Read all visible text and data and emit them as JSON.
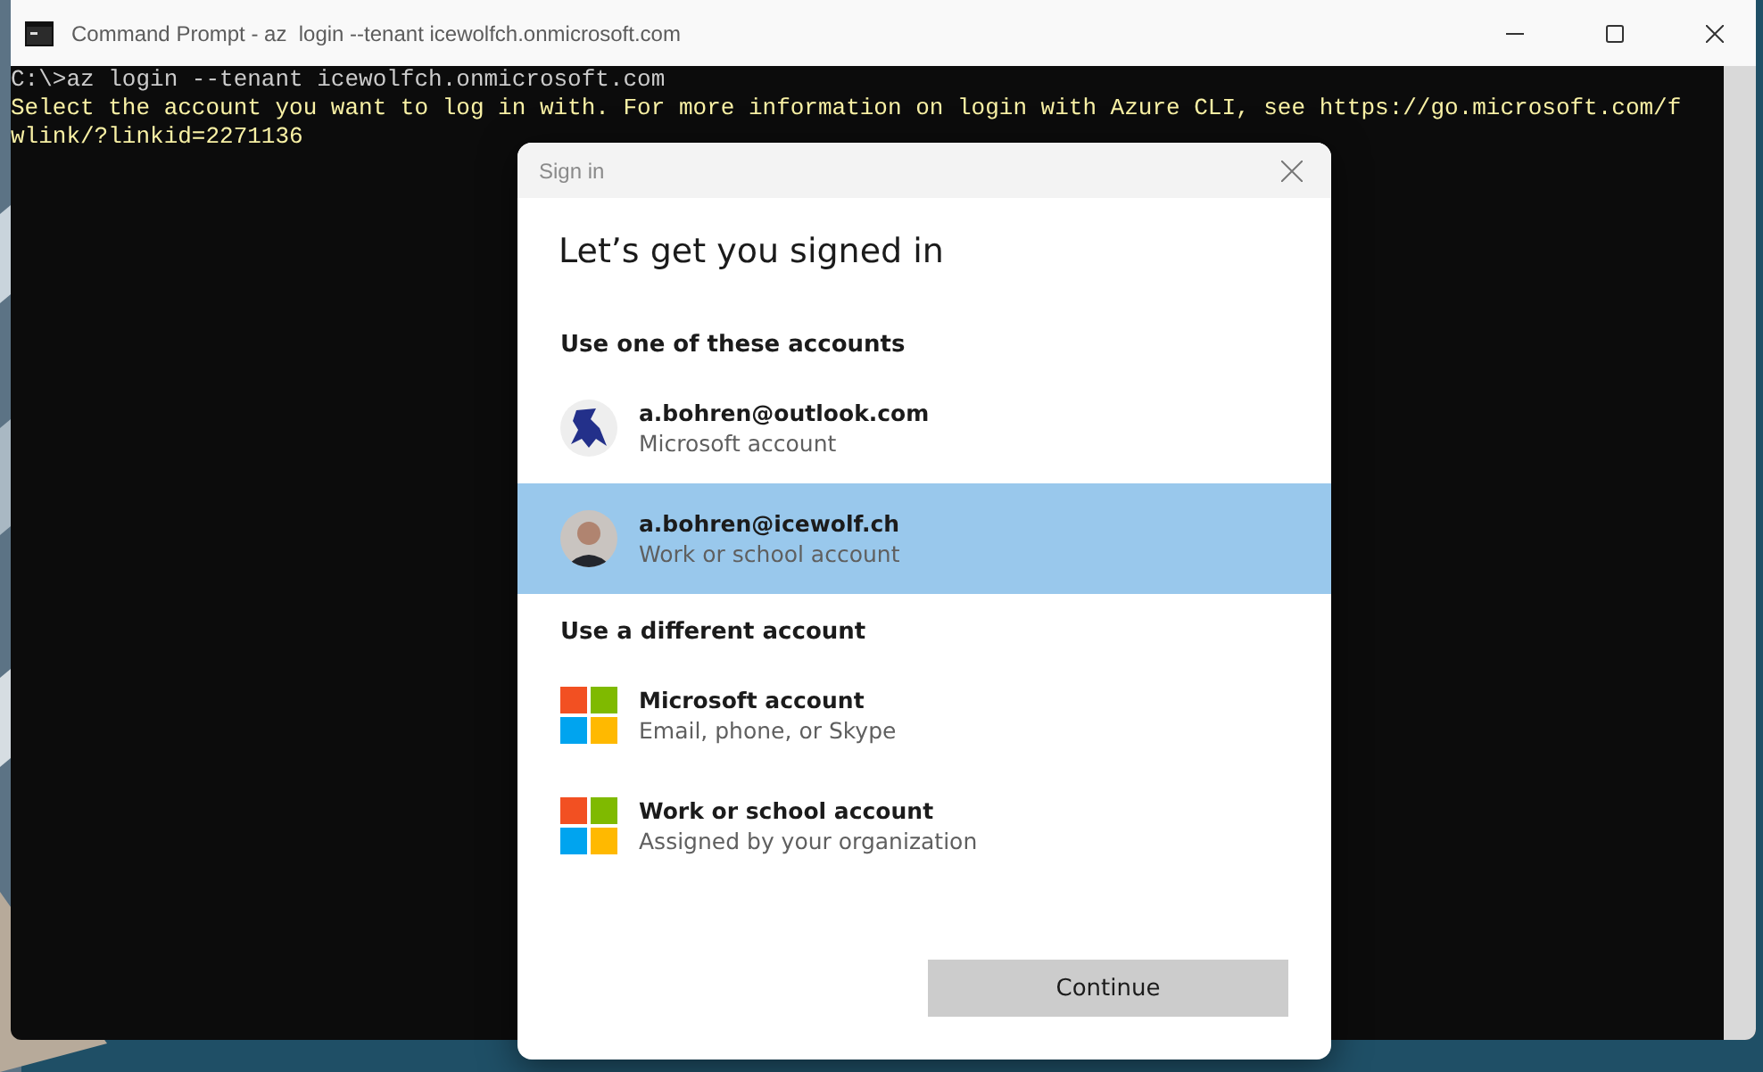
{
  "terminal": {
    "title": "Command Prompt - az  login --tenant icewolfch.onmicrosoft.com",
    "lines": [
      {
        "kind": "command",
        "text": "C:\\>az login --tenant icewolfch.onmicrosoft.com"
      },
      {
        "kind": "output",
        "text": "Select the account you want to log in with. For more information on login with Azure CLI, see https://go.microsoft.com/f"
      },
      {
        "kind": "output",
        "text": "wlink/?linkid=2271136"
      }
    ]
  },
  "dialog": {
    "title": "Sign in",
    "heading": "Let’s get you signed in",
    "sections": [
      {
        "heading": "Use one of these accounts",
        "items": [
          {
            "kind": "mascot",
            "name": "a.bohren@outlook.com",
            "detail": "Microsoft account",
            "selected": false
          },
          {
            "kind": "person",
            "name": "a.bohren@icewolf.ch",
            "detail": "Work or school account",
            "selected": true
          }
        ]
      },
      {
        "heading": "Use a different account",
        "items": [
          {
            "kind": "logo",
            "name": "Microsoft account",
            "detail": "Email, phone, or Skype",
            "selected": false
          },
          {
            "kind": "logo",
            "name": "Work or school account",
            "detail": "Assigned by your organization",
            "selected": false
          }
        ]
      }
    ],
    "button": "Continue"
  }
}
